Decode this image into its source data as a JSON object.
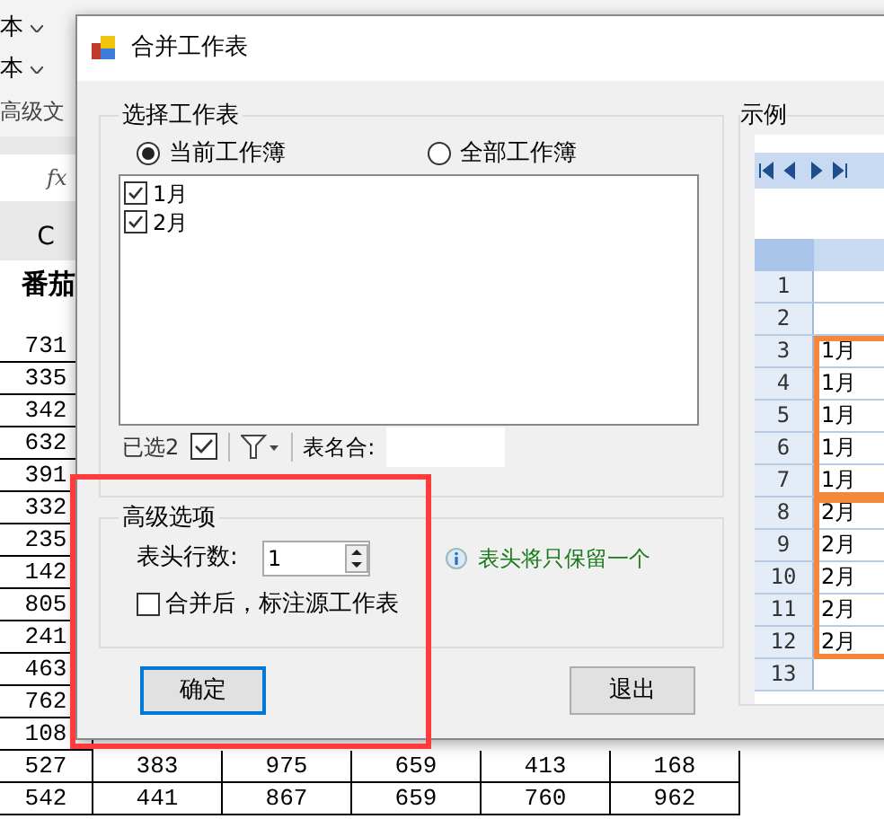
{
  "spreadsheet": {
    "ribbon": [
      {
        "label": "本"
      },
      {
        "label": "本"
      }
    ],
    "group_label": "高级文",
    "formula_icon": "fx",
    "column_header": "C",
    "header_cell": "番茄",
    "rows": [
      {
        "cells": [
          "731"
        ]
      },
      {
        "cells": [
          "335"
        ]
      },
      {
        "cells": [
          "342"
        ]
      },
      {
        "cells": [
          "632"
        ]
      },
      {
        "cells": [
          "391"
        ]
      },
      {
        "cells": [
          "332"
        ]
      },
      {
        "cells": [
          "235"
        ]
      },
      {
        "cells": [
          "142"
        ]
      },
      {
        "cells": [
          "805"
        ]
      },
      {
        "cells": [
          "241"
        ]
      },
      {
        "cells": [
          "463"
        ]
      },
      {
        "cells": [
          "762"
        ]
      },
      {
        "cells": [
          "108"
        ]
      },
      {
        "cells": [
          "527",
          "383",
          "975",
          "659",
          "413",
          "168"
        ]
      },
      {
        "cells": [
          "542",
          "441",
          "867",
          "659",
          "760",
          "962"
        ]
      }
    ]
  },
  "dialog": {
    "title": "合并工作表",
    "select_group": {
      "title": "选择工作表",
      "scopes": [
        {
          "label": "当前工作簿",
          "selected": true
        },
        {
          "label": "全部工作簿",
          "selected": false
        }
      ],
      "sheets": [
        {
          "label": "1月",
          "checked": true
        },
        {
          "label": "2月",
          "checked": true
        }
      ],
      "selected_count": "已选2",
      "name_filter_label": "表名合:"
    },
    "advanced": {
      "title": "高级选项",
      "header_rows_label": "表头行数:",
      "header_rows_value": "1",
      "annotate": {
        "label": "合并后，标注源工作表",
        "checked": false
      },
      "hint": "表头将只保留一个"
    },
    "buttons": [
      {
        "label": "确定",
        "focused": true
      },
      {
        "label": "退出",
        "focused": false
      }
    ],
    "example": {
      "title": "示例",
      "sections": [
        {
          "kind": "plain",
          "rows": [
            {
              "num": "1"
            },
            {
              "num": "2"
            }
          ]
        },
        {
          "kind": "block",
          "rows": [
            {
              "num": "3",
              "value": "1月"
            },
            {
              "num": "4",
              "value": "1月"
            },
            {
              "num": "5",
              "value": "1月"
            },
            {
              "num": "6",
              "value": "1月"
            },
            {
              "num": "7",
              "value": "1月"
            }
          ]
        },
        {
          "kind": "block",
          "rows": [
            {
              "num": "8",
              "value": "2月"
            },
            {
              "num": "9",
              "value": "2月"
            },
            {
              "num": "10",
              "value": "2月"
            },
            {
              "num": "11",
              "value": "2月"
            },
            {
              "num": "12",
              "value": "2月"
            }
          ]
        },
        {
          "kind": "plain",
          "rows": [
            {
              "num": "13"
            }
          ]
        }
      ]
    }
  }
}
